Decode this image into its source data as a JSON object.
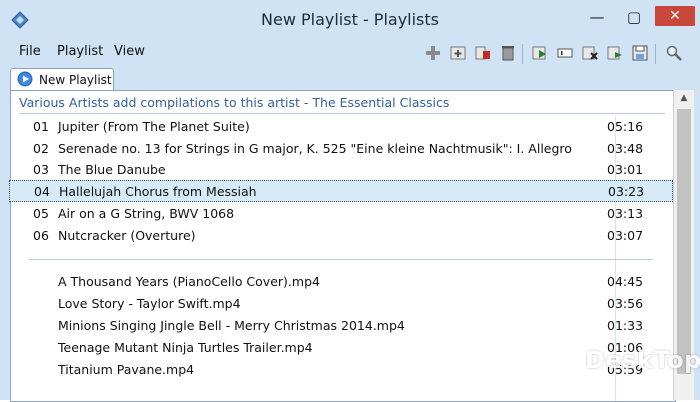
{
  "window": {
    "title": "New Playlist - Playlists",
    "controls": {
      "minimize": "—",
      "maximize": "▢",
      "close": "✕"
    }
  },
  "menu": {
    "file": "File",
    "playlist": "Playlist",
    "view": "View"
  },
  "toolbar": {
    "icons": [
      "add-icon",
      "add-folder-icon",
      "remove-icon",
      "trash-icon",
      "play-selected-icon",
      "rename-icon",
      "delete-icon",
      "export-icon",
      "save-icon",
      "search-icon"
    ]
  },
  "tab": {
    "label": "New Playlist"
  },
  "playlist": {
    "group_header": "Various Artists add compilations to this artist - The Essential Classics",
    "tracks": [
      {
        "num": "01",
        "title": "Jupiter (From The Planet Suite)",
        "duration": "05:16"
      },
      {
        "num": "02",
        "title": "Serenade no. 13 for Strings in G major, K. 525 \"Eine kleine Nachtmusik\": I. Allegro",
        "duration": "03:48"
      },
      {
        "num": "03",
        "title": "The Blue Danube",
        "duration": "03:01"
      },
      {
        "num": "04",
        "title": "Hallelujah Chorus from Messiah",
        "duration": "03:23"
      },
      {
        "num": "05",
        "title": "Air on a G String, BWV 1068",
        "duration": "03:13"
      },
      {
        "num": "06",
        "title": "Nutcracker (Overture)",
        "duration": "03:07"
      }
    ],
    "files": [
      {
        "title": "A Thousand Years (PianoCello Cover).mp4",
        "duration": "04:45"
      },
      {
        "title": "Love Story - Taylor Swift.mp4",
        "duration": "03:56"
      },
      {
        "title": "Minions Singing Jingle Bell - Merry Christmas 2014.mp4",
        "duration": "01:33"
      },
      {
        "title": "Teenage Mutant Ninja Turtles Trailer.mp4",
        "duration": "01:06"
      },
      {
        "title": "Titanium  Pavane.mp4",
        "duration": "05:59"
      }
    ]
  },
  "watermark": {
    "text": "DeskTop"
  },
  "colors": {
    "titlebar": "#cfe3f5",
    "selection": "#d6eaf8",
    "group_header": "#3360a0",
    "close_button": "#c9473b"
  }
}
